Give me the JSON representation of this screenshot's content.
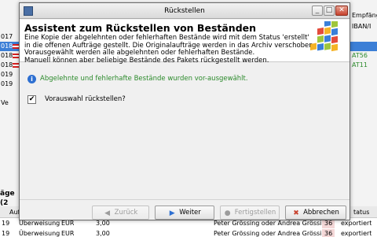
{
  "background": {
    "left_cells": [
      "017",
      "018",
      "018",
      "018",
      "019",
      "019",
      "Ve"
    ],
    "left_group_header": "äge (2",
    "right_cells": [
      "Empfäng",
      "IBAN/I",
      "",
      "AT56",
      "AT11",
      "",
      ""
    ],
    "bottom_header": "Auftr",
    "bottom_header_right": "tatus",
    "bottom_row1": {
      "a": "19",
      "b": "Überweisung",
      "c": "EUR",
      "d": "3,00",
      "e": "Peter Grössing oder Andrea Grössing",
      "f": "36",
      "g": "exportiert"
    },
    "bottom_row2": {
      "a": "19",
      "b": "Überweisung",
      "c": "EUR",
      "d": "3,00",
      "e": "Peter Grössing oder Andrea Grössing",
      "f": "36",
      "g": "exportiert"
    }
  },
  "dialog": {
    "title": "Rückstellen",
    "heading": "Assistent zum Rückstellen von Beständen",
    "description": [
      "Eine Kopie der abgelehnten oder fehlerhaften Bestände wird mit dem Status 'erstellt'",
      "in die offenen Aufträge gestellt. Die Originalaufträge werden in das Archiv verschoben.",
      "Vorausgewählt werden alle abgelehnten oder fehlerhaften Bestände.",
      "Manuell können aber beliebige Bestände des Pakets rückgestellt werden."
    ],
    "info_text": "Abgelehnte und fehlerhafte Bestände wurden vor-ausgewählt.",
    "checkbox": {
      "label": "Vorauswahl rückstellen?",
      "checked": true,
      "mark": "✔"
    },
    "buttons": {
      "back": "Zurück",
      "next": "Weiter",
      "finish": "Fertigstellen",
      "cancel": "Abbrechen"
    }
  },
  "colors": {
    "selection": "#3c7fd6",
    "info_text": "#2b8a2b",
    "cancel_icon": "#c8432f"
  }
}
